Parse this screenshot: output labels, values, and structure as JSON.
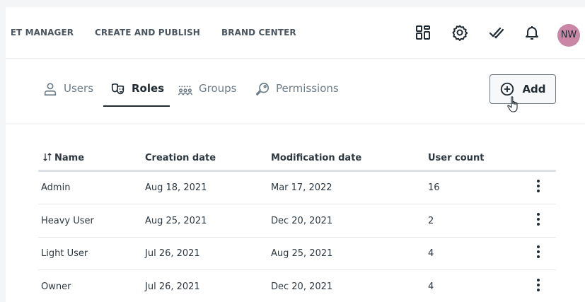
{
  "nav": {
    "items": [
      "SET MANAGER",
      "CREATE AND PUBLISH",
      "BRAND CENTER"
    ],
    "icons": [
      "apps-icon",
      "gear-icon",
      "tasks-check-icon",
      "bell-icon"
    ],
    "avatar_initials": "NW"
  },
  "tabs": [
    {
      "label": "Users",
      "icon": "user-icon",
      "active": false
    },
    {
      "label": "Roles",
      "icon": "masks-icon",
      "active": true
    },
    {
      "label": "Groups",
      "icon": "group-icon",
      "active": false
    },
    {
      "label": "Permissions",
      "icon": "key-icon",
      "active": false
    }
  ],
  "add_button": {
    "label": "Add",
    "icon": "plus-circle-icon"
  },
  "table": {
    "columns": [
      "Name",
      "Creation date",
      "Modification date",
      "User count"
    ],
    "sort_icon": "sort-arrows-icon",
    "rows": [
      {
        "name": "Admin",
        "created": "Aug 18, 2021",
        "modified": "Mar 17, 2022",
        "users": "16"
      },
      {
        "name": "Heavy User",
        "created": "Aug 25, 2021",
        "modified": "Dec 20, 2021",
        "users": "2"
      },
      {
        "name": "Light User",
        "created": "Jul 26, 2021",
        "modified": "Aug 25, 2021",
        "users": "4"
      },
      {
        "name": "Owner",
        "created": "Jul 26, 2021",
        "modified": "Dec 20, 2021",
        "users": "4"
      }
    ]
  },
  "colors": {
    "avatar_bg": "#c986a5",
    "text_dark": "#1f2a33",
    "tab_inactive": "#6b7b88"
  }
}
